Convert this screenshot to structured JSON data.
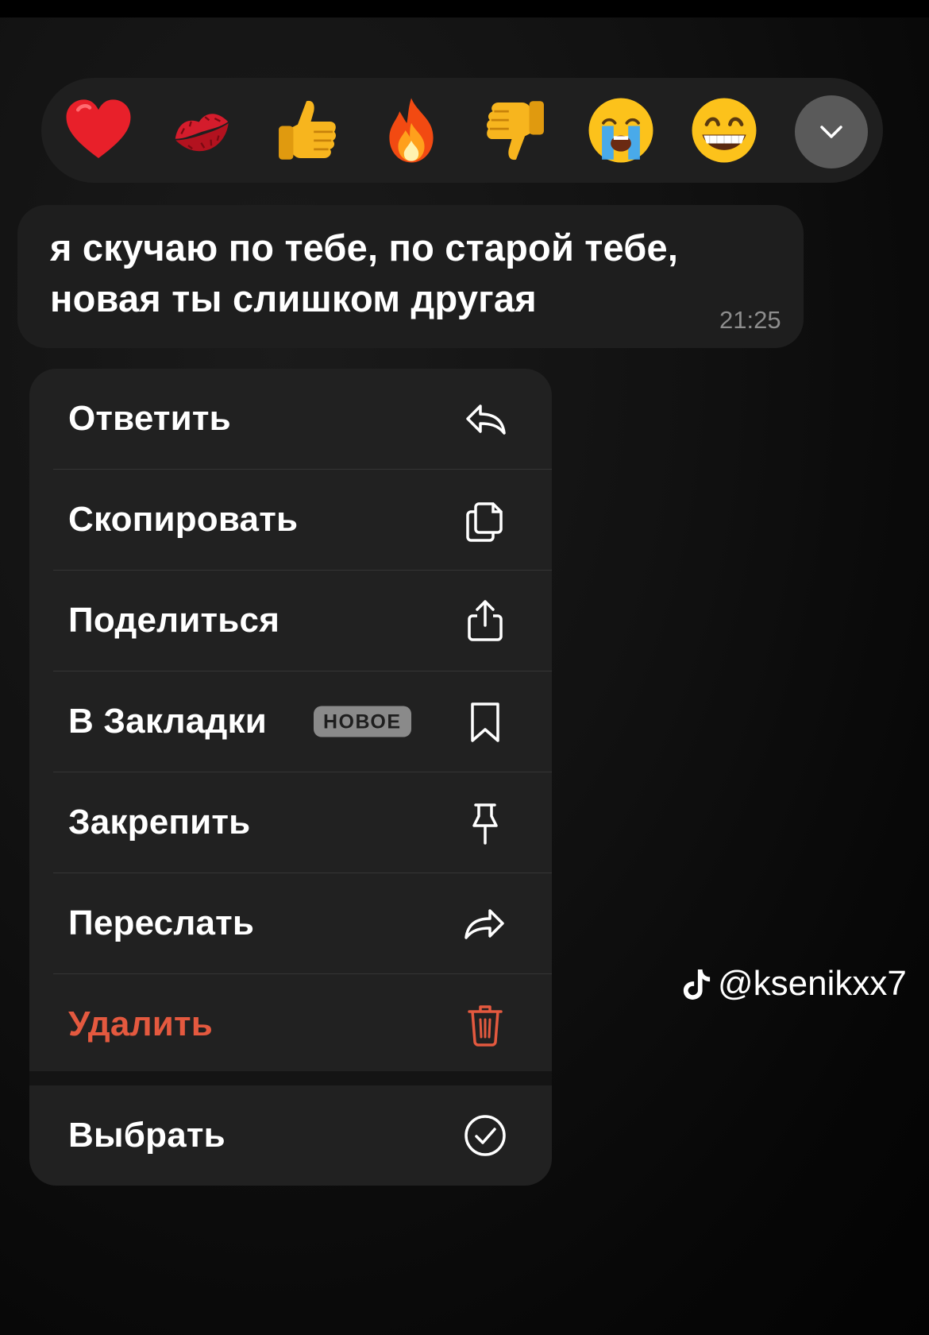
{
  "reactions": [
    {
      "emoji": "❤️",
      "icon": "red-heart-icon"
    },
    {
      "emoji": "💋",
      "icon": "kiss-mark-icon"
    },
    {
      "emoji": "👍",
      "icon": "thumbs-up-icon"
    },
    {
      "emoji": "🔥",
      "icon": "fire-icon"
    },
    {
      "emoji": "👎",
      "icon": "thumbs-down-icon"
    },
    {
      "emoji": "😭",
      "icon": "crying-face-icon"
    },
    {
      "emoji": "😁",
      "icon": "grinning-face-icon"
    }
  ],
  "expand_icon": "chevron-down-icon",
  "message": {
    "text": "я скучаю по тебе, по старой тебе, новая ты слишком другая",
    "time": "21:25"
  },
  "menu": {
    "reply": {
      "label": "Ответить",
      "icon": "reply-arrow-icon"
    },
    "copy": {
      "label": "Скопировать",
      "icon": "copy-icon"
    },
    "share": {
      "label": "Поделиться",
      "icon": "share-icon"
    },
    "bookmark": {
      "label": "В Закладки",
      "badge": "НОВОЕ",
      "icon": "bookmark-icon"
    },
    "pin": {
      "label": "Закрепить",
      "icon": "pin-icon"
    },
    "forward": {
      "label": "Переслать",
      "icon": "forward-arrow-icon"
    },
    "delete": {
      "label": "Удалить",
      "icon": "trash-icon"
    },
    "select": {
      "label": "Выбрать",
      "icon": "checkmark-circle-icon"
    }
  },
  "colors": {
    "menu_background": "#212121",
    "bubble_background": "#1e1e1e",
    "destructive": "#e4593f",
    "badge_background": "#8a8a8a"
  },
  "watermark": {
    "handle": "@ksenikxx7",
    "icon": "tiktok-logo-icon"
  }
}
